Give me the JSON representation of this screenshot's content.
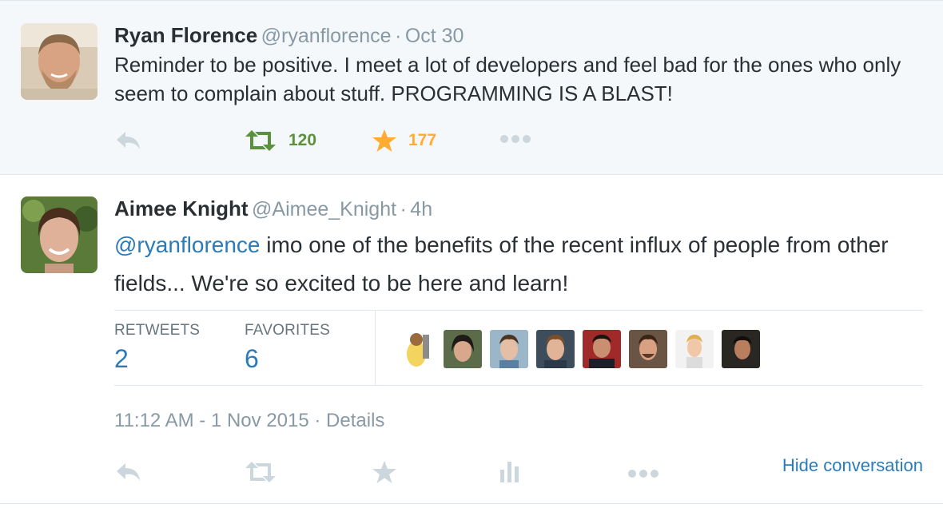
{
  "tweet1": {
    "author_name": "Ryan Florence",
    "handle": "@ryanflorence",
    "separator": "·",
    "time": "Oct 30",
    "text": "Reminder to be positive. I meet a lot of developers and feel bad for the ones who only seem to complain about stuff. PROGRAMMING IS A BLAST!",
    "retweet_count": "120",
    "favorite_count": "177"
  },
  "tweet2": {
    "author_name": "Aimee Knight",
    "handle": "@Aimee_Knight",
    "separator": "·",
    "time": "4h",
    "mention": "@ryanflorence",
    "text": " imo one of the benefits of the recent influx of people from other fields... We're so excited to be here and learn!",
    "stats": {
      "retweets_label": "RETWEETS",
      "retweets_value": "2",
      "favorites_label": "FAVORITES",
      "favorites_value": "6"
    },
    "timestamp": "11:12 AM - 1 Nov 2015",
    "details_separator": "·",
    "details_link": "Details",
    "hide_conversation": "Hide conversation"
  },
  "colors": {
    "retweet_active": "#5c913b",
    "favorite_active": "#ffac33",
    "action_inactive": "#ccd6dd",
    "link": "#2b7bb9"
  }
}
